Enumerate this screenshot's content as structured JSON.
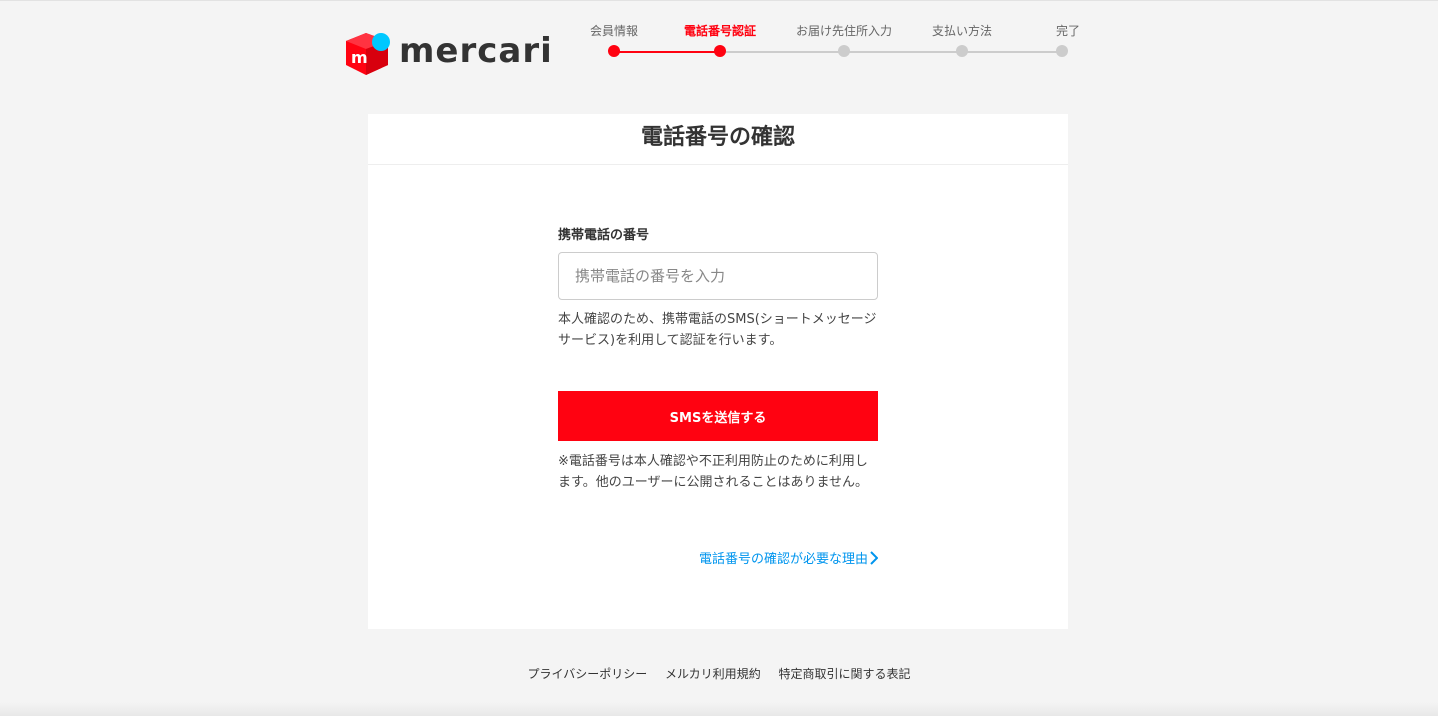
{
  "brand": {
    "logo_text": "mercari",
    "logo_color": "#ff0211",
    "logo_accent": "#00c8ff"
  },
  "stepper": {
    "current_index": 1,
    "steps": [
      {
        "label": "会員情報"
      },
      {
        "label": "電話番号認証"
      },
      {
        "label": "お届け先住所入力"
      },
      {
        "label": "支払い方法"
      },
      {
        "label": "完了"
      }
    ]
  },
  "card": {
    "title": "電話番号の確認",
    "phone_label": "携帯電話の番号",
    "phone_value": "",
    "phone_placeholder": "携帯電話の番号を入力",
    "help_text": "本人確認のため、携帯電話のSMS(ショートメッセージサービス)を利用して認証を行います。",
    "send_button": "SMSを送信する",
    "note": "※電話番号は本人確認や不正利用防止のために利用します。他のユーザーに公開されることはありません。",
    "reason_link": "電話番号の確認が必要な理由"
  },
  "footer": {
    "links": [
      {
        "label": "プライバシーポリシー"
      },
      {
        "label": "メルカリ利用規約"
      },
      {
        "label": "特定商取引に関する表記"
      }
    ]
  },
  "colors": {
    "primary": "#ff0211",
    "link": "#0095ee",
    "inactive": "#cccccc",
    "background": "#f4f4f4"
  }
}
